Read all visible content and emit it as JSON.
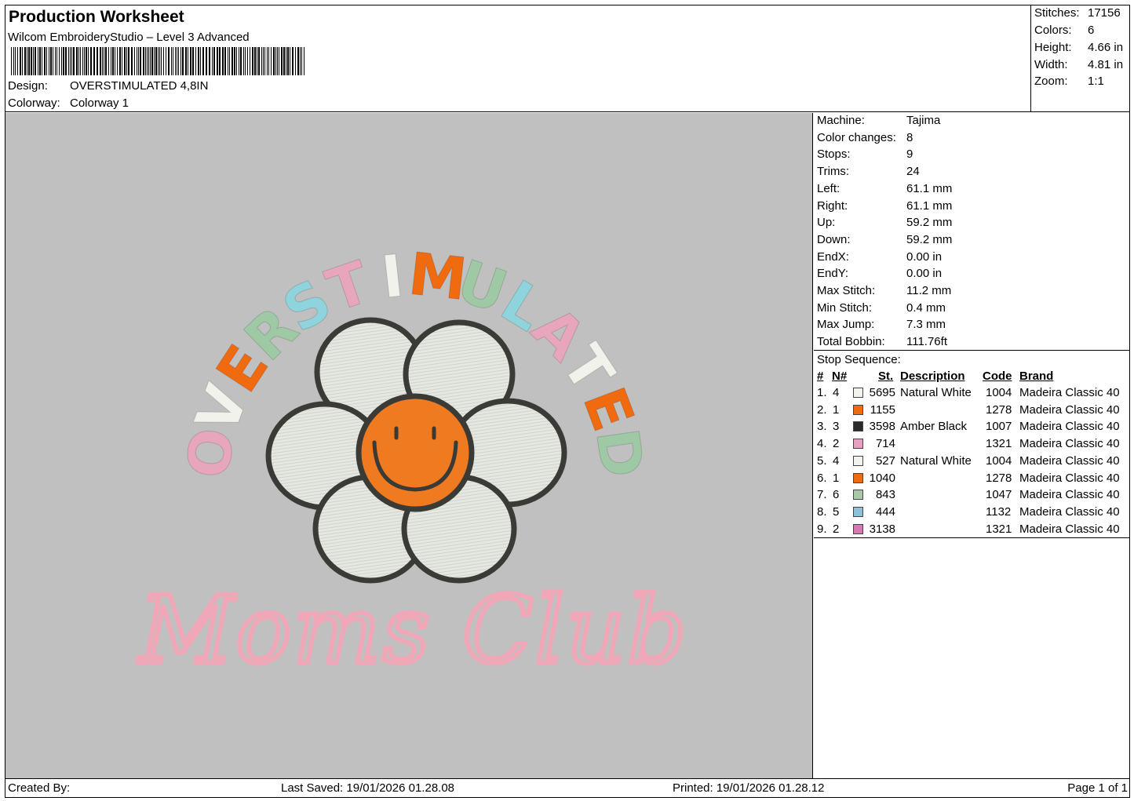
{
  "header": {
    "title": "Production Worksheet",
    "software": "Wilcom EmbroideryStudio – Level 3 Advanced",
    "design_label": "Design:",
    "design_value": "OVERSTIMULATED 4,8IN",
    "colorway_label": "Colorway:",
    "colorway_value": "Colorway 1"
  },
  "stats": [
    {
      "label": "Stitches:",
      "value": "17156"
    },
    {
      "label": "Colors:",
      "value": "6"
    },
    {
      "label": "Height:",
      "value": "4.66 in"
    },
    {
      "label": "Width:",
      "value": "4.81 in"
    },
    {
      "label": "Zoom:",
      "value": "1:1"
    }
  ],
  "machine_info": [
    {
      "label": "Machine:",
      "value": "Tajima"
    },
    {
      "label": "Color changes:",
      "value": "8"
    },
    {
      "label": "Stops:",
      "value": "9"
    },
    {
      "label": "Trims:",
      "value": "24"
    },
    {
      "label": "Left:",
      "value": "61.1 mm"
    },
    {
      "label": "Right:",
      "value": "61.1 mm"
    },
    {
      "label": "Up:",
      "value": "59.2 mm"
    },
    {
      "label": "Down:",
      "value": "59.2 mm"
    },
    {
      "label": "EndX:",
      "value": "0.00 in"
    },
    {
      "label": "EndY:",
      "value": "0.00 in"
    },
    {
      "label": "Max Stitch:",
      "value": "11.2 mm"
    },
    {
      "label": "Min Stitch:",
      "value": "0.4 mm"
    },
    {
      "label": "Max Jump:",
      "value": "7.3 mm"
    },
    {
      "label": "Total Bobbin:",
      "value": "111.76ft"
    }
  ],
  "stop_sequence": {
    "title": "Stop Sequence:",
    "headers": {
      "num": "#",
      "n": "N#",
      "st": "St.",
      "description": "Description",
      "code": "Code",
      "brand": "Brand"
    },
    "rows": [
      {
        "num": "1.",
        "n": "4",
        "color": "#f2f2ee",
        "st": "5695",
        "description": "Natural White",
        "code": "1004",
        "brand": "Madeira Classic 40"
      },
      {
        "num": "2.",
        "n": "1",
        "color": "#f06a10",
        "st": "1155",
        "description": "",
        "code": "1278",
        "brand": "Madeira Classic 40"
      },
      {
        "num": "3.",
        "n": "3",
        "color": "#2a2a2a",
        "st": "3598",
        "description": "Amber Black",
        "code": "1007",
        "brand": "Madeira Classic 40"
      },
      {
        "num": "4.",
        "n": "2",
        "color": "#e8a0c0",
        "st": "714",
        "description": "",
        "code": "1321",
        "brand": "Madeira Classic 40"
      },
      {
        "num": "5.",
        "n": "4",
        "color": "#f2f2ee",
        "st": "527",
        "description": "Natural White",
        "code": "1004",
        "brand": "Madeira Classic 40"
      },
      {
        "num": "6.",
        "n": "1",
        "color": "#f06a10",
        "st": "1040",
        "description": "",
        "code": "1278",
        "brand": "Madeira Classic 40"
      },
      {
        "num": "7.",
        "n": "6",
        "color": "#a8c8a8",
        "st": "843",
        "description": "",
        "code": "1047",
        "brand": "Madeira Classic 40"
      },
      {
        "num": "8.",
        "n": "5",
        "color": "#8ec0d8",
        "st": "444",
        "description": "",
        "code": "1132",
        "brand": "Madeira Classic 40"
      },
      {
        "num": "9.",
        "n": "2",
        "color": "#d878b0",
        "st": "3138",
        "description": "",
        "code": "1321",
        "brand": "Madeira Classic 40"
      }
    ]
  },
  "artwork": {
    "arc_text": "OVERSTIMULATED",
    "arc_colors": [
      "#e8a6bc",
      "#f2f2ec",
      "#f06a10",
      "#9ec9a4",
      "#8fd3dc",
      "#e8a6bc",
      "#f2f2ec",
      "#f06a10",
      "#9ec9a4",
      "#8fd3dc",
      "#e8a6bc",
      "#f2f2ec",
      "#f06a10",
      "#9ec9a4"
    ],
    "script_text": "Moms Club",
    "script_color": "#f0a8b8",
    "petal_color": "#e8ece4",
    "outline_color": "#3a3a36",
    "center_color": "#f07a20"
  },
  "footer": {
    "created_by": "Created By:",
    "last_saved": "Last Saved: 19/01/2026 01.28.08",
    "printed": "Printed: 19/01/2026 01.28.12",
    "page": "Page 1 of 1"
  }
}
